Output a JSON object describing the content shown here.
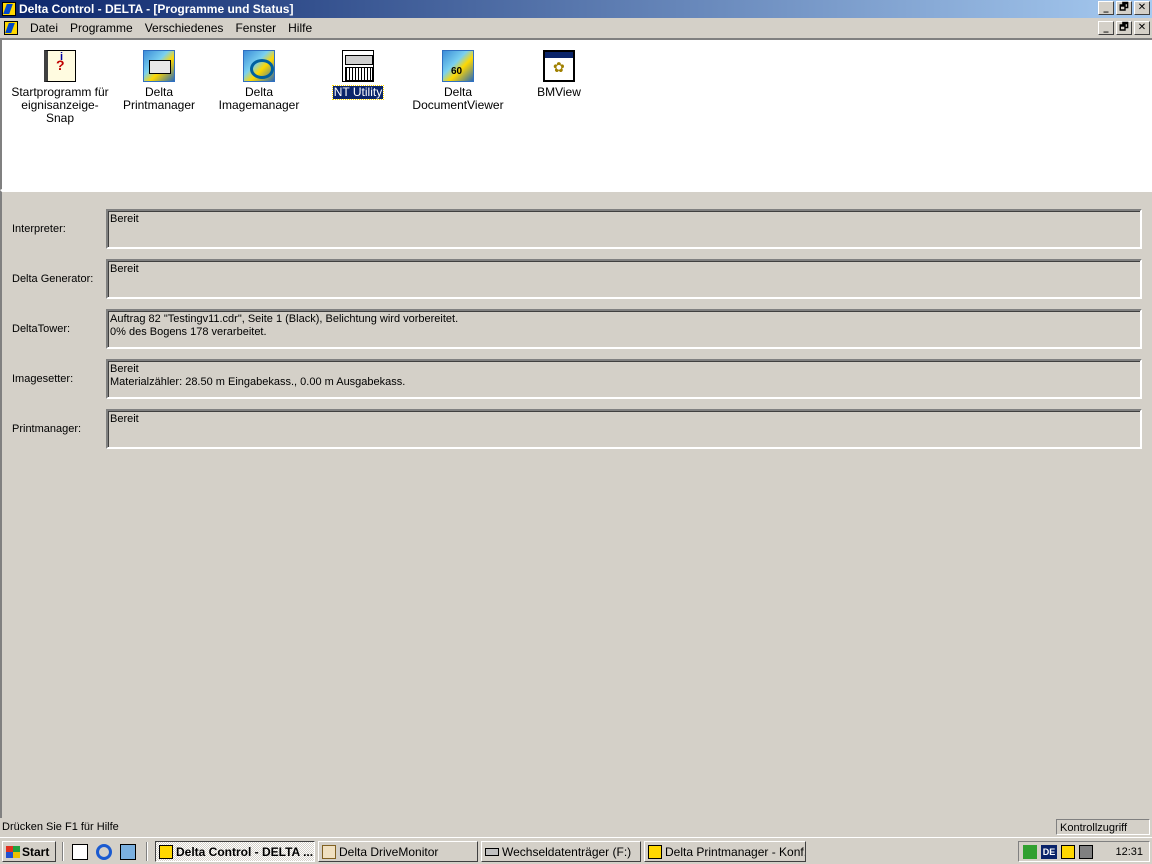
{
  "window": {
    "title": "Delta Control - DELTA - [Programme und Status]",
    "buttons": {
      "minimize": "_",
      "restore": "🗗",
      "close": "✕"
    }
  },
  "menubar": {
    "items": [
      "Datei",
      "Programme",
      "Verschiedenes",
      "Fenster",
      "Hilfe"
    ]
  },
  "programs": [
    {
      "label": "Startprogramm für\neignisanzeige-Snap",
      "icon": "event-book-icon",
      "selected": false
    },
    {
      "label": "Delta Printmanager",
      "icon": "delta-printmanager-icon",
      "selected": false
    },
    {
      "label": "Delta\nImagemanager",
      "icon": "delta-imagemanager-icon",
      "selected": false
    },
    {
      "label": "NT Utility",
      "icon": "nt-utility-icon",
      "selected": true
    },
    {
      "label": "Delta\nDocumentViewer",
      "icon": "delta-documentviewer-icon",
      "selected": false
    },
    {
      "label": "BMView",
      "icon": "bmview-icon",
      "selected": false
    }
  ],
  "status": [
    {
      "label": "Interpreter:",
      "text": "Bereit"
    },
    {
      "label": "Delta Generator:",
      "text": "Bereit"
    },
    {
      "label": "DeltaTower:",
      "text": "Auftrag 82 \"Testingv11.cdr\", Seite 1 (Black), Belichtung wird vorbereitet.\n0% des Bogens 178 verarbeitet."
    },
    {
      "label": "Imagesetter:",
      "text": "Bereit\nMaterialzähler: 28.50 m Eingabekass., 0.00 m Ausgabekass."
    },
    {
      "label": "Printmanager:",
      "text": "Bereit"
    }
  ],
  "statusbar": {
    "message": "Drücken Sie F1 für Hilfe",
    "panel": "Kontrollzugriff"
  },
  "taskbar": {
    "start": "Start",
    "tasks": [
      {
        "label": "Delta Control - DELTA ...",
        "active": true
      },
      {
        "label": "Delta DriveMonitor",
        "active": false
      },
      {
        "label": "Wechseldatenträger (F:)",
        "active": false
      },
      {
        "label": "Delta Printmanager - Konf...",
        "active": false
      }
    ],
    "tray": {
      "lang": "DE",
      "clock": "12:31"
    }
  }
}
